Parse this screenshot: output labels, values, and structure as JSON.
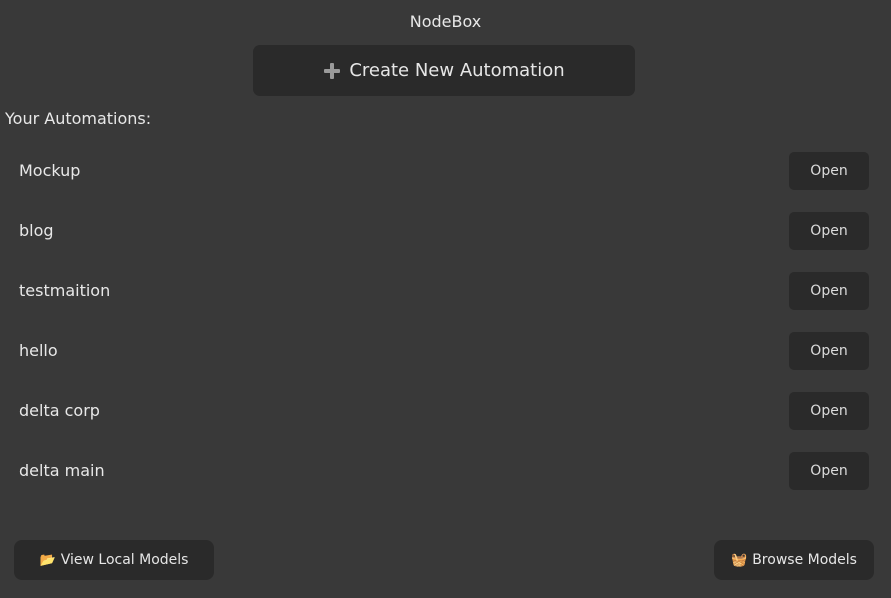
{
  "app": {
    "title": "NodeBox"
  },
  "create": {
    "label": "Create New Automation",
    "icon": "plus-icon"
  },
  "section": {
    "label": "Your Automations:"
  },
  "automations": [
    {
      "name": "Mockup",
      "action": "Open"
    },
    {
      "name": "blog",
      "action": "Open"
    },
    {
      "name": "testmaition",
      "action": "Open"
    },
    {
      "name": "hello",
      "action": "Open"
    },
    {
      "name": "delta corp",
      "action": "Open"
    },
    {
      "name": "delta main",
      "action": "Open"
    }
  ],
  "footer": {
    "view_local": {
      "icon": "📂",
      "icon_name": "open-folder-icon",
      "label": "View Local Models"
    },
    "browse": {
      "icon": "🧺",
      "icon_name": "basket-icon",
      "label": "Browse Models"
    }
  },
  "colors": {
    "background": "#393939",
    "button": "#2a2a2a",
    "text": "#e8e8e8"
  }
}
